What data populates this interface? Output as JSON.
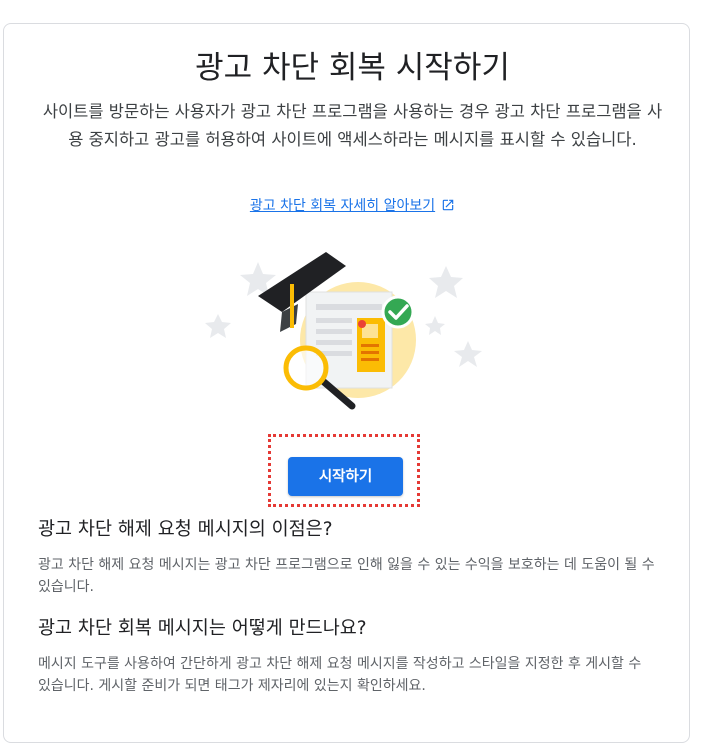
{
  "header": {
    "title": "광고 차단 회복 시작하기",
    "description": "사이트를 방문하는 사용자가 광고 차단 프로그램을 사용하는 경우 광고 차단 프로그램을 사용 중지하고 광고를 허용하여 사이트에 액세스하라는 메시지를 표시할 수 있습니다.",
    "learn_more_link": "광고 차단 회복 자세히 알아보기",
    "external_link_icon": "open-in-new-icon"
  },
  "illustration": {
    "icon": "ad-page-with-magnifier-and-checkmark-illustration",
    "colors": {
      "page": "#e8eaed",
      "accent": "#fbbc04",
      "check": "#34a853",
      "circle": "#fde8a8"
    }
  },
  "actions": {
    "start_label": "시작하기"
  },
  "faq": [
    {
      "question": "광고 차단 해제 요청 메시지의 이점은?",
      "answer": "광고 차단 해제 요청 메시지는 광고 차단 프로그램으로 인해 잃을 수 있는 수익을 보호하는 데 도움이 될 수 있습니다."
    },
    {
      "question": "광고 차단 회복 메시지는 어떻게 만드나요?",
      "answer": "메시지 도구를 사용하여 간단하게 광고 차단 해제 요청 메시지를 작성하고 스타일을 지정한 후 게시할 수 있습니다. 게시할 준비가 되면 태그가 제자리에 있는지 확인하세요."
    }
  ],
  "colors": {
    "primary": "#1a73e8",
    "highlight_outline": "#e53935"
  }
}
